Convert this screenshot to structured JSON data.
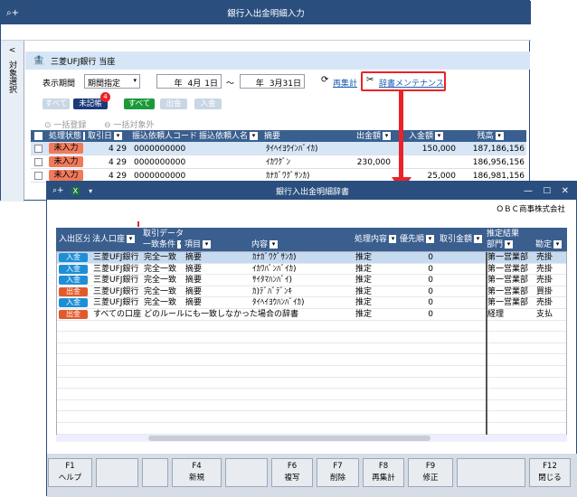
{
  "back": {
    "title": "銀行入出金明細入力",
    "side_label": "対象選択",
    "side_arrow": "<",
    "bank": "三菱UFJ銀行 当座",
    "period_label": "表示期間",
    "period_value": "期間指定",
    "from_year": "年",
    "from_month": "4月",
    "from_day": "1日",
    "tilde": "～",
    "to_year": "年",
    "to_date": "3月31日",
    "recalc": "再集計",
    "dict_maint": "辞書メンテナンス",
    "filters1": [
      "すべて",
      "未記帳",
      "すべて",
      "出金",
      "入金"
    ],
    "unrec_count": "4",
    "bulk_reg": "一括登録",
    "bulk_excl": "一括対象外",
    "columns": [
      "処理状態",
      "取引日",
      "振込依頼人コード",
      "振込依頼人名",
      "摘要",
      "出金額",
      "入金額",
      "残高"
    ],
    "rows": [
      {
        "status": "未入力",
        "date": "4 29",
        "code": "0000000000",
        "name": "",
        "memo": "ﾀｲﾍｲﾖｳｲﾝﾊﾞｲｶ)",
        "out": "",
        "in": "150,000",
        "bal": "187,186,156"
      },
      {
        "status": "未入力",
        "date": "4 29",
        "code": "0000000000",
        "name": "",
        "memo": "ｲｶﾜｸﾞﾝ",
        "out": "230,000",
        "in": "",
        "bal": "186,956,156"
      },
      {
        "status": "未入力",
        "date": "4 29",
        "code": "0000000000",
        "name": "",
        "memo": "ｶﾅｶﾞﾜｸﾞｻﾝｶ)",
        "out": "",
        "in": "25,000",
        "bal": "186,981,156"
      }
    ]
  },
  "front": {
    "title": "銀行入出金明細辞書",
    "company": "ＯＢＣ商事株式会社",
    "columns": {
      "inout": "入出区分",
      "bank": "法人口座",
      "txn_group": "取引データ",
      "match": "一致条件",
      "item": "項目",
      "content": "内容",
      "proc": "処理内容",
      "priority": "優先順",
      "amount": "取引金額",
      "result_group": "推定結果",
      "dept": "部門",
      "acct": "勘定"
    },
    "rows": [
      {
        "inout": "入金",
        "bank": "三菱UFJ銀行",
        "match": "完全一致",
        "item": "摘要",
        "content": "ｶﾅｶﾞﾜｸﾞｻﾝｶ)",
        "proc": "推定",
        "pri": "0",
        "dept": "第一営業部",
        "acct": "売掛"
      },
      {
        "inout": "入金",
        "bank": "三菱UFJ銀行",
        "match": "完全一致",
        "item": "摘要",
        "content": "ｲｶﾜﾊﾞﾝﾊﾞｲｶ)",
        "proc": "推定",
        "pri": "0",
        "dept": "第一営業部",
        "acct": "売掛"
      },
      {
        "inout": "入金",
        "bank": "三菱UFJ銀行",
        "match": "完全一致",
        "item": "摘要",
        "content": "ｻｲﾀﾏﾊﾝﾊﾞｲ)",
        "proc": "推定",
        "pri": "0",
        "dept": "第一営業部",
        "acct": "売掛"
      },
      {
        "inout": "出金",
        "bank": "三菱UFJ銀行",
        "match": "完全一致",
        "item": "摘要",
        "content": "ｶ)ﾃﾞﾊﾞﾃﾞﾝｷ",
        "proc": "推定",
        "pri": "0",
        "dept": "第一営業部",
        "acct": "買掛"
      },
      {
        "inout": "入金",
        "bank": "三菱UFJ銀行",
        "match": "完全一致",
        "item": "摘要",
        "content": "ﾀｲﾍｲﾖｳﾊﾝﾊﾞｲｶ)",
        "proc": "推定",
        "pri": "0",
        "dept": "第一営業部",
        "acct": "売掛"
      },
      {
        "inout": "出金",
        "bank": "すべての口座",
        "match": "どのルールにも一致しなかった場合の辞書",
        "item": "",
        "content": "",
        "proc": "推定",
        "pri": "0",
        "dept": "経理",
        "acct": "支払"
      }
    ],
    "fkeys": [
      {
        "k": "F1",
        "l": "ヘルプ"
      },
      {
        "k": "",
        "l": ""
      },
      {
        "k": "",
        "l": ""
      },
      {
        "k": "F4",
        "l": "新規"
      },
      {
        "k": "",
        "l": ""
      },
      {
        "k": "F6",
        "l": "複写"
      },
      {
        "k": "F7",
        "l": "削除"
      },
      {
        "k": "F8",
        "l": "再集計"
      },
      {
        "k": "F9",
        "l": "修正"
      },
      {
        "k": "",
        "l": ""
      },
      {
        "k": "F12",
        "l": "閉じる"
      }
    ]
  },
  "colors": {
    "title": "#2a4f7f",
    "header": "#3a5f8f",
    "highlight": "#e8232a",
    "in": "#1e8fd6",
    "out": "#e05a2a"
  }
}
